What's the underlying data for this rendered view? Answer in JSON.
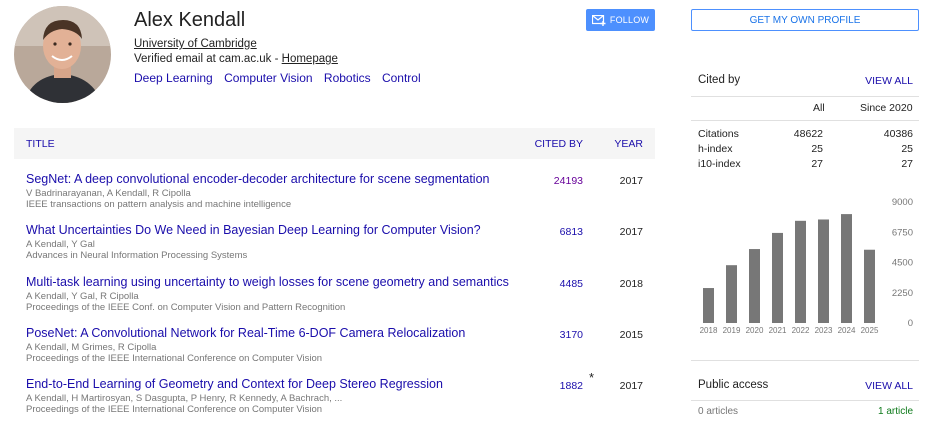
{
  "profile": {
    "name": "Alex Kendall",
    "affiliation": "University of Cambridge",
    "email_text": "Verified email at cam.ac.uk - ",
    "homepage": "Homepage",
    "interests": [
      "Deep Learning",
      "Computer Vision",
      "Robotics",
      "Control"
    ],
    "follow_label": "FOLLOW"
  },
  "table": {
    "headers": {
      "title": "TITLE",
      "cited": "CITED BY",
      "year": "YEAR"
    },
    "rows": [
      {
        "title": "SegNet: A deep convolutional encoder-decoder architecture for scene segmentation",
        "authors": "V Badrinarayanan, A Kendall, R Cipolla",
        "venue": "IEEE transactions on pattern analysis and machine intelligence",
        "cited": "24193",
        "year": "2017"
      },
      {
        "title": "What Uncertainties Do We Need in Bayesian Deep Learning for Computer Vision?",
        "authors": "A Kendall, Y Gal",
        "venue": "Advances in Neural Information Processing Systems",
        "cited": "6813",
        "year": "2017"
      },
      {
        "title": "Multi-task learning using uncertainty to weigh losses for scene geometry and semantics",
        "authors": "A Kendall, Y Gal, R Cipolla",
        "venue": "Proceedings of the IEEE Conf. on Computer Vision and Pattern Recognition",
        "cited": "4485",
        "year": "2018"
      },
      {
        "title": "PoseNet: A Convolutional Network for Real-Time 6-DOF Camera Relocalization",
        "authors": "A Kendall, M Grimes, R Cipolla",
        "venue": "Proceedings of the IEEE International Conference on Computer Vision",
        "cited": "3170",
        "year": "2015"
      },
      {
        "title": "End-to-End Learning of Geometry and Context for Deep Stereo Regression",
        "authors": "A Kendall, H Martirosyan, S Dasgupta, P Henry, R Kennedy, A Bachrach, ...",
        "venue": "Proceedings of the IEEE International Conference on Computer Vision",
        "cited": "1882",
        "year": "2017",
        "star": "*"
      }
    ]
  },
  "sidebar": {
    "get_profile_label": "GET MY OWN PROFILE",
    "cited_by_title": "Cited by",
    "view_all": "VIEW ALL",
    "col_all": "All",
    "col_since": "Since 2020",
    "stats": [
      {
        "label": "Citations",
        "all": "48622",
        "since": "40386"
      },
      {
        "label": "h-index",
        "all": "25",
        "since": "25"
      },
      {
        "label": "i10-index",
        "all": "27",
        "since": "27"
      }
    ],
    "public_access_title": "Public access",
    "public_access_view_all": "VIEW ALL",
    "articles_unavailable": "0 articles",
    "articles_available": "1 article"
  },
  "colors": {
    "link": "#1a0dab",
    "visited": "#660099",
    "accent": "#4d90fe",
    "bar": "#777777",
    "available": "#0d7a1a"
  },
  "chart_data": {
    "type": "bar",
    "categories": [
      "2018",
      "2019",
      "2020",
      "2021",
      "2022",
      "2023",
      "2024",
      "2025"
    ],
    "values": [
      2600,
      4300,
      5500,
      6700,
      7600,
      7700,
      8100,
      5450
    ],
    "yticks": [
      "0",
      "2250",
      "4500",
      "6750",
      "9000"
    ],
    "ylim": [
      0,
      9000
    ]
  }
}
